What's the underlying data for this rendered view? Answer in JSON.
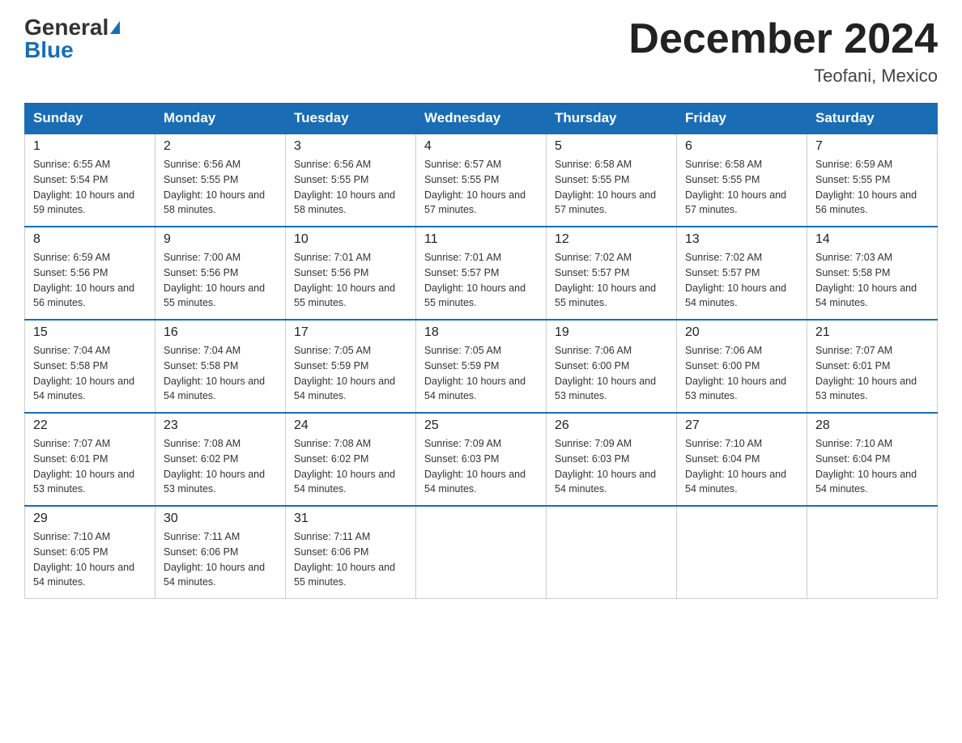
{
  "logo": {
    "general": "General",
    "blue": "Blue",
    "tagline": "GeneralBlue"
  },
  "title": {
    "month_year": "December 2024",
    "location": "Teofani, Mexico"
  },
  "days_of_week": [
    "Sunday",
    "Monday",
    "Tuesday",
    "Wednesday",
    "Thursday",
    "Friday",
    "Saturday"
  ],
  "weeks": [
    [
      {
        "day": "1",
        "sunrise": "Sunrise: 6:55 AM",
        "sunset": "Sunset: 5:54 PM",
        "daylight": "Daylight: 10 hours and 59 minutes."
      },
      {
        "day": "2",
        "sunrise": "Sunrise: 6:56 AM",
        "sunset": "Sunset: 5:55 PM",
        "daylight": "Daylight: 10 hours and 58 minutes."
      },
      {
        "day": "3",
        "sunrise": "Sunrise: 6:56 AM",
        "sunset": "Sunset: 5:55 PM",
        "daylight": "Daylight: 10 hours and 58 minutes."
      },
      {
        "day": "4",
        "sunrise": "Sunrise: 6:57 AM",
        "sunset": "Sunset: 5:55 PM",
        "daylight": "Daylight: 10 hours and 57 minutes."
      },
      {
        "day": "5",
        "sunrise": "Sunrise: 6:58 AM",
        "sunset": "Sunset: 5:55 PM",
        "daylight": "Daylight: 10 hours and 57 minutes."
      },
      {
        "day": "6",
        "sunrise": "Sunrise: 6:58 AM",
        "sunset": "Sunset: 5:55 PM",
        "daylight": "Daylight: 10 hours and 57 minutes."
      },
      {
        "day": "7",
        "sunrise": "Sunrise: 6:59 AM",
        "sunset": "Sunset: 5:55 PM",
        "daylight": "Daylight: 10 hours and 56 minutes."
      }
    ],
    [
      {
        "day": "8",
        "sunrise": "Sunrise: 6:59 AM",
        "sunset": "Sunset: 5:56 PM",
        "daylight": "Daylight: 10 hours and 56 minutes."
      },
      {
        "day": "9",
        "sunrise": "Sunrise: 7:00 AM",
        "sunset": "Sunset: 5:56 PM",
        "daylight": "Daylight: 10 hours and 55 minutes."
      },
      {
        "day": "10",
        "sunrise": "Sunrise: 7:01 AM",
        "sunset": "Sunset: 5:56 PM",
        "daylight": "Daylight: 10 hours and 55 minutes."
      },
      {
        "day": "11",
        "sunrise": "Sunrise: 7:01 AM",
        "sunset": "Sunset: 5:57 PM",
        "daylight": "Daylight: 10 hours and 55 minutes."
      },
      {
        "day": "12",
        "sunrise": "Sunrise: 7:02 AM",
        "sunset": "Sunset: 5:57 PM",
        "daylight": "Daylight: 10 hours and 55 minutes."
      },
      {
        "day": "13",
        "sunrise": "Sunrise: 7:02 AM",
        "sunset": "Sunset: 5:57 PM",
        "daylight": "Daylight: 10 hours and 54 minutes."
      },
      {
        "day": "14",
        "sunrise": "Sunrise: 7:03 AM",
        "sunset": "Sunset: 5:58 PM",
        "daylight": "Daylight: 10 hours and 54 minutes."
      }
    ],
    [
      {
        "day": "15",
        "sunrise": "Sunrise: 7:04 AM",
        "sunset": "Sunset: 5:58 PM",
        "daylight": "Daylight: 10 hours and 54 minutes."
      },
      {
        "day": "16",
        "sunrise": "Sunrise: 7:04 AM",
        "sunset": "Sunset: 5:58 PM",
        "daylight": "Daylight: 10 hours and 54 minutes."
      },
      {
        "day": "17",
        "sunrise": "Sunrise: 7:05 AM",
        "sunset": "Sunset: 5:59 PM",
        "daylight": "Daylight: 10 hours and 54 minutes."
      },
      {
        "day": "18",
        "sunrise": "Sunrise: 7:05 AM",
        "sunset": "Sunset: 5:59 PM",
        "daylight": "Daylight: 10 hours and 54 minutes."
      },
      {
        "day": "19",
        "sunrise": "Sunrise: 7:06 AM",
        "sunset": "Sunset: 6:00 PM",
        "daylight": "Daylight: 10 hours and 53 minutes."
      },
      {
        "day": "20",
        "sunrise": "Sunrise: 7:06 AM",
        "sunset": "Sunset: 6:00 PM",
        "daylight": "Daylight: 10 hours and 53 minutes."
      },
      {
        "day": "21",
        "sunrise": "Sunrise: 7:07 AM",
        "sunset": "Sunset: 6:01 PM",
        "daylight": "Daylight: 10 hours and 53 minutes."
      }
    ],
    [
      {
        "day": "22",
        "sunrise": "Sunrise: 7:07 AM",
        "sunset": "Sunset: 6:01 PM",
        "daylight": "Daylight: 10 hours and 53 minutes."
      },
      {
        "day": "23",
        "sunrise": "Sunrise: 7:08 AM",
        "sunset": "Sunset: 6:02 PM",
        "daylight": "Daylight: 10 hours and 53 minutes."
      },
      {
        "day": "24",
        "sunrise": "Sunrise: 7:08 AM",
        "sunset": "Sunset: 6:02 PM",
        "daylight": "Daylight: 10 hours and 54 minutes."
      },
      {
        "day": "25",
        "sunrise": "Sunrise: 7:09 AM",
        "sunset": "Sunset: 6:03 PM",
        "daylight": "Daylight: 10 hours and 54 minutes."
      },
      {
        "day": "26",
        "sunrise": "Sunrise: 7:09 AM",
        "sunset": "Sunset: 6:03 PM",
        "daylight": "Daylight: 10 hours and 54 minutes."
      },
      {
        "day": "27",
        "sunrise": "Sunrise: 7:10 AM",
        "sunset": "Sunset: 6:04 PM",
        "daylight": "Daylight: 10 hours and 54 minutes."
      },
      {
        "day": "28",
        "sunrise": "Sunrise: 7:10 AM",
        "sunset": "Sunset: 6:04 PM",
        "daylight": "Daylight: 10 hours and 54 minutes."
      }
    ],
    [
      {
        "day": "29",
        "sunrise": "Sunrise: 7:10 AM",
        "sunset": "Sunset: 6:05 PM",
        "daylight": "Daylight: 10 hours and 54 minutes."
      },
      {
        "day": "30",
        "sunrise": "Sunrise: 7:11 AM",
        "sunset": "Sunset: 6:06 PM",
        "daylight": "Daylight: 10 hours and 54 minutes."
      },
      {
        "day": "31",
        "sunrise": "Sunrise: 7:11 AM",
        "sunset": "Sunset: 6:06 PM",
        "daylight": "Daylight: 10 hours and 55 minutes."
      },
      {
        "day": "",
        "sunrise": "",
        "sunset": "",
        "daylight": ""
      },
      {
        "day": "",
        "sunrise": "",
        "sunset": "",
        "daylight": ""
      },
      {
        "day": "",
        "sunrise": "",
        "sunset": "",
        "daylight": ""
      },
      {
        "day": "",
        "sunrise": "",
        "sunset": "",
        "daylight": ""
      }
    ]
  ]
}
